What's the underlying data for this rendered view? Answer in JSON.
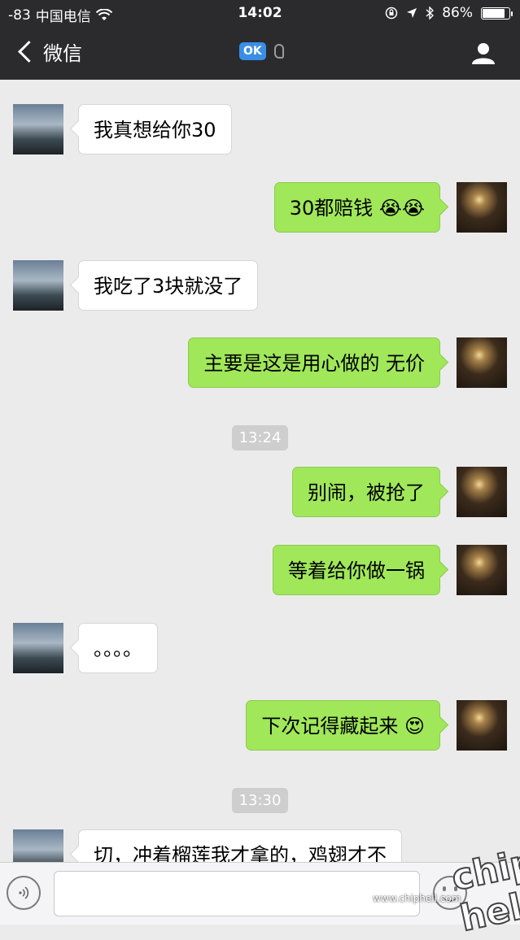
{
  "status_bar": {
    "signal": "-83",
    "carrier": "中国电信",
    "time": "14:02",
    "battery": "86%",
    "battery_level": 0.86
  },
  "nav": {
    "back_label": "微信",
    "badge": "OK"
  },
  "messages": [
    {
      "side": "in",
      "text": "我真想给你30"
    },
    {
      "side": "out",
      "text": "30都赔钱 😭😭"
    },
    {
      "side": "in",
      "text": "我吃了3块就没了"
    },
    {
      "side": "out",
      "text": "主要是这是用心做的 无价"
    },
    {
      "timestamp": "13:24"
    },
    {
      "side": "out",
      "text": "别闹，被抢了"
    },
    {
      "side": "out",
      "text": "等着给你做一锅"
    },
    {
      "side": "in",
      "text": "。。。。"
    },
    {
      "side": "out",
      "text": "下次记得藏起来 😍"
    },
    {
      "timestamp": "13:30"
    },
    {
      "side": "in",
      "text": "切，冲着榴莲我才拿的，鸡翅才不"
    }
  ],
  "input": {
    "placeholder": ""
  },
  "watermark": {
    "url": "www.chiphell.com",
    "logo": "chip hell"
  }
}
